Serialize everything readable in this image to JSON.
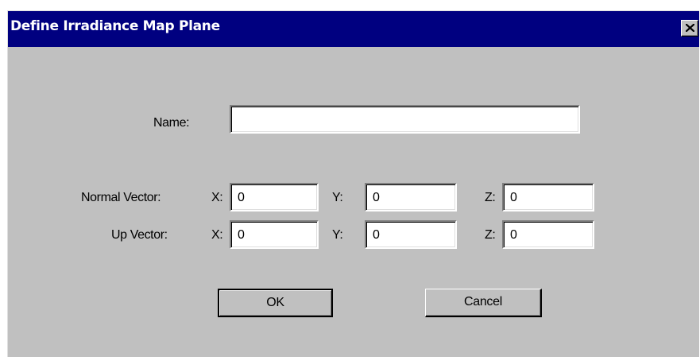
{
  "window": {
    "title": "Define Irradiance Map Plane"
  },
  "icons": {
    "close": "close-icon"
  },
  "form": {
    "name_label": "Name:",
    "name_value": "",
    "normal_label": "Normal Vector:",
    "up_label": "Up Vector:",
    "x_label": "X:",
    "y_label": "Y:",
    "z_label": "Z:",
    "normal": {
      "x": "0",
      "y": "0",
      "z": "0"
    },
    "up": {
      "x": "0",
      "y": "0",
      "z": "0"
    }
  },
  "buttons": {
    "ok": "OK",
    "cancel": "Cancel"
  },
  "colors": {
    "titlebar": "#000080",
    "face": "#c0c0c0"
  }
}
